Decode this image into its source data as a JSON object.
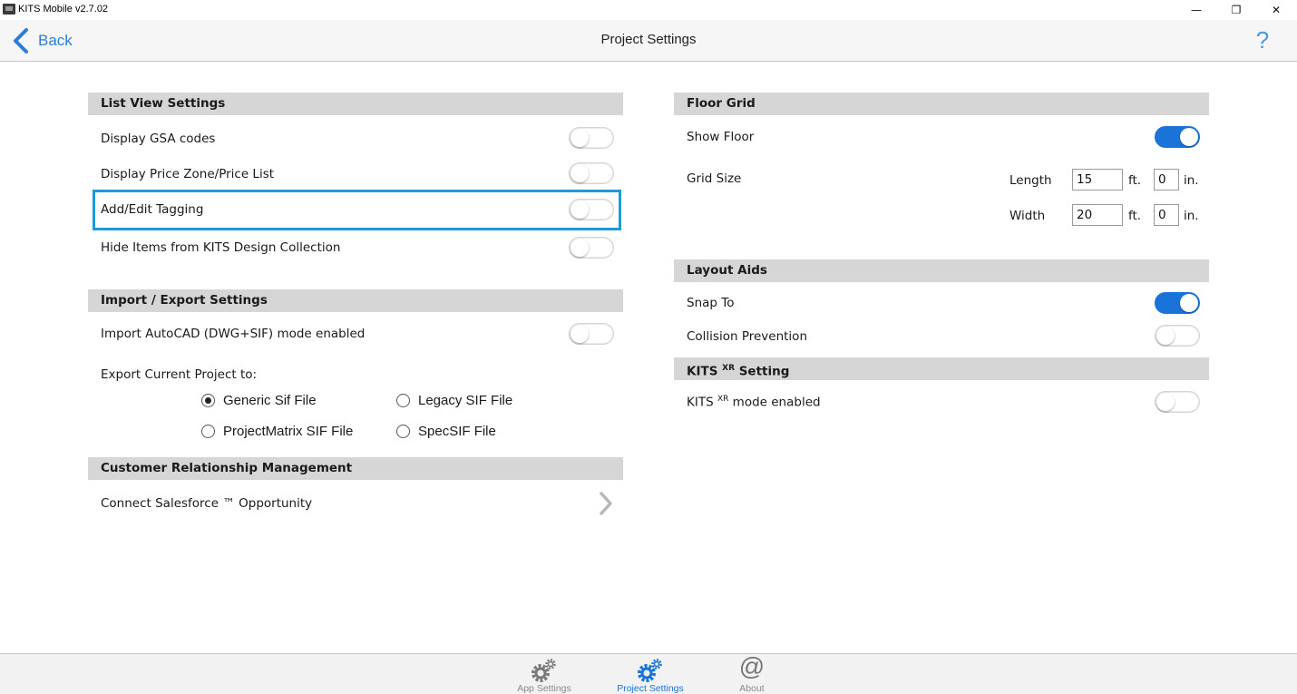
{
  "window": {
    "title": "KITS Mobile v2.7.02",
    "minimize_glyph": "—",
    "maximize_glyph": "❐",
    "close_glyph": "✕"
  },
  "header": {
    "back_label": "Back",
    "title": "Project Settings",
    "help_glyph": "?"
  },
  "list_view": {
    "title": "List View Settings",
    "display_gsa": {
      "label": "Display GSA codes",
      "on": false
    },
    "display_price_zone": {
      "label": "Display Price Zone/Price List",
      "on": false
    },
    "add_edit_tagging": {
      "label": "Add/Edit Tagging",
      "on": false
    },
    "hide_items": {
      "label": "Hide Items from KITS Design Collection",
      "on": false
    }
  },
  "import_export": {
    "title": "Import / Export Settings",
    "import_autocad": {
      "label": "Import AutoCAD (DWG+SIF) mode enabled",
      "on": false
    },
    "export_label": "Export Current Project to:",
    "options": {
      "generic": {
        "label": "Generic Sif File",
        "checked": true
      },
      "legacy": {
        "label": "Legacy SIF File",
        "checked": false
      },
      "projectmatrix": {
        "label": "ProjectMatrix SIF File",
        "checked": false
      },
      "specsif": {
        "label": "SpecSIF File",
        "checked": false
      }
    }
  },
  "crm": {
    "title": "Customer Relationship Management",
    "salesforce_label": "Connect Salesforce ™ Opportunity"
  },
  "floor_grid": {
    "title": "Floor Grid",
    "show_floor": {
      "label": "Show Floor",
      "on": true
    },
    "grid_size_label": "Grid Size",
    "length_label": "Length",
    "width_label": "Width",
    "length_ft": "15",
    "length_in": "0",
    "width_ft": "20",
    "width_in": "0",
    "ft_unit": "ft.",
    "in_unit": "in."
  },
  "layout_aids": {
    "title": "Layout Aids",
    "snap_to": {
      "label": "Snap To",
      "on": true
    },
    "collision_prevention": {
      "label": "Collision Prevention",
      "on": false
    }
  },
  "kits_xr": {
    "title_prefix": "KITS",
    "title_sup": "XR",
    "title_suffix": "Setting",
    "mode_prefix": "KITS",
    "mode_sup": "XR",
    "mode_suffix": "mode enabled",
    "mode_on": false
  },
  "tabs": {
    "app_settings": "App Settings",
    "project_settings": "Project Settings",
    "about": "About",
    "about_glyph": "@"
  },
  "colors": {
    "accent": "#1a73d8",
    "highlight": "#1e9ad6",
    "section_bg": "#d6d6d6"
  }
}
